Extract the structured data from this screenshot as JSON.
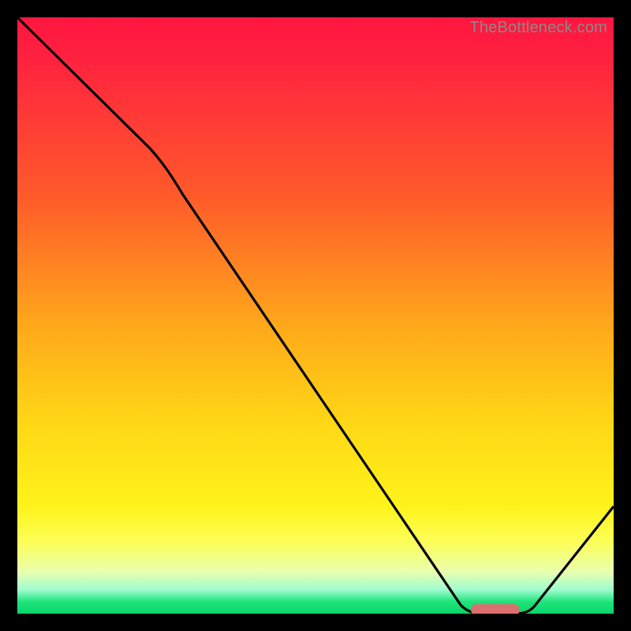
{
  "watermark": "TheBottleneck.com",
  "chart_data": {
    "type": "line",
    "title": "",
    "xlabel": "",
    "ylabel": "",
    "xlim": [
      0,
      100
    ],
    "ylim": [
      0,
      100
    ],
    "series": [
      {
        "name": "bottleneck-curve",
        "x": [
          0,
          22,
          76,
          84,
          100
        ],
        "y": [
          100,
          78,
          0,
          0,
          18
        ]
      }
    ],
    "marker": {
      "name": "optimal-range",
      "x_start": 76,
      "x_end": 84,
      "y": 0,
      "color": "#d9706f"
    },
    "gradient_stops": [
      {
        "pos": 0.0,
        "color": "#ff153f"
      },
      {
        "pos": 0.3,
        "color": "#ff5a2a"
      },
      {
        "pos": 0.52,
        "color": "#ffa91a"
      },
      {
        "pos": 0.82,
        "color": "#fff31a"
      },
      {
        "pos": 1.0,
        "color": "#08d66a"
      }
    ]
  }
}
